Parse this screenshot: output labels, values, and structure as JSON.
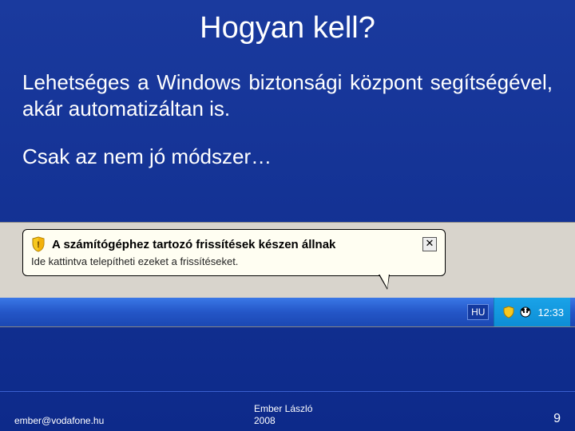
{
  "title": "Hogyan kell?",
  "paragraph1": "Lehetséges a Windows biztonsági központ segítségével, akár automatizáltan is.",
  "paragraph2": "Csak az nem jó módszer…",
  "balloon": {
    "title": "A számítógéphez tartozó frissítések készen állnak",
    "message": "Ide kattintva telepítheti ezeket a frissítéseket.",
    "close": "✕"
  },
  "taskbar": {
    "language": "HU",
    "clock": "12:33"
  },
  "footer": {
    "email": "ember@vodafone.hu",
    "author": "Ember László",
    "year": "2008",
    "page": "9"
  }
}
